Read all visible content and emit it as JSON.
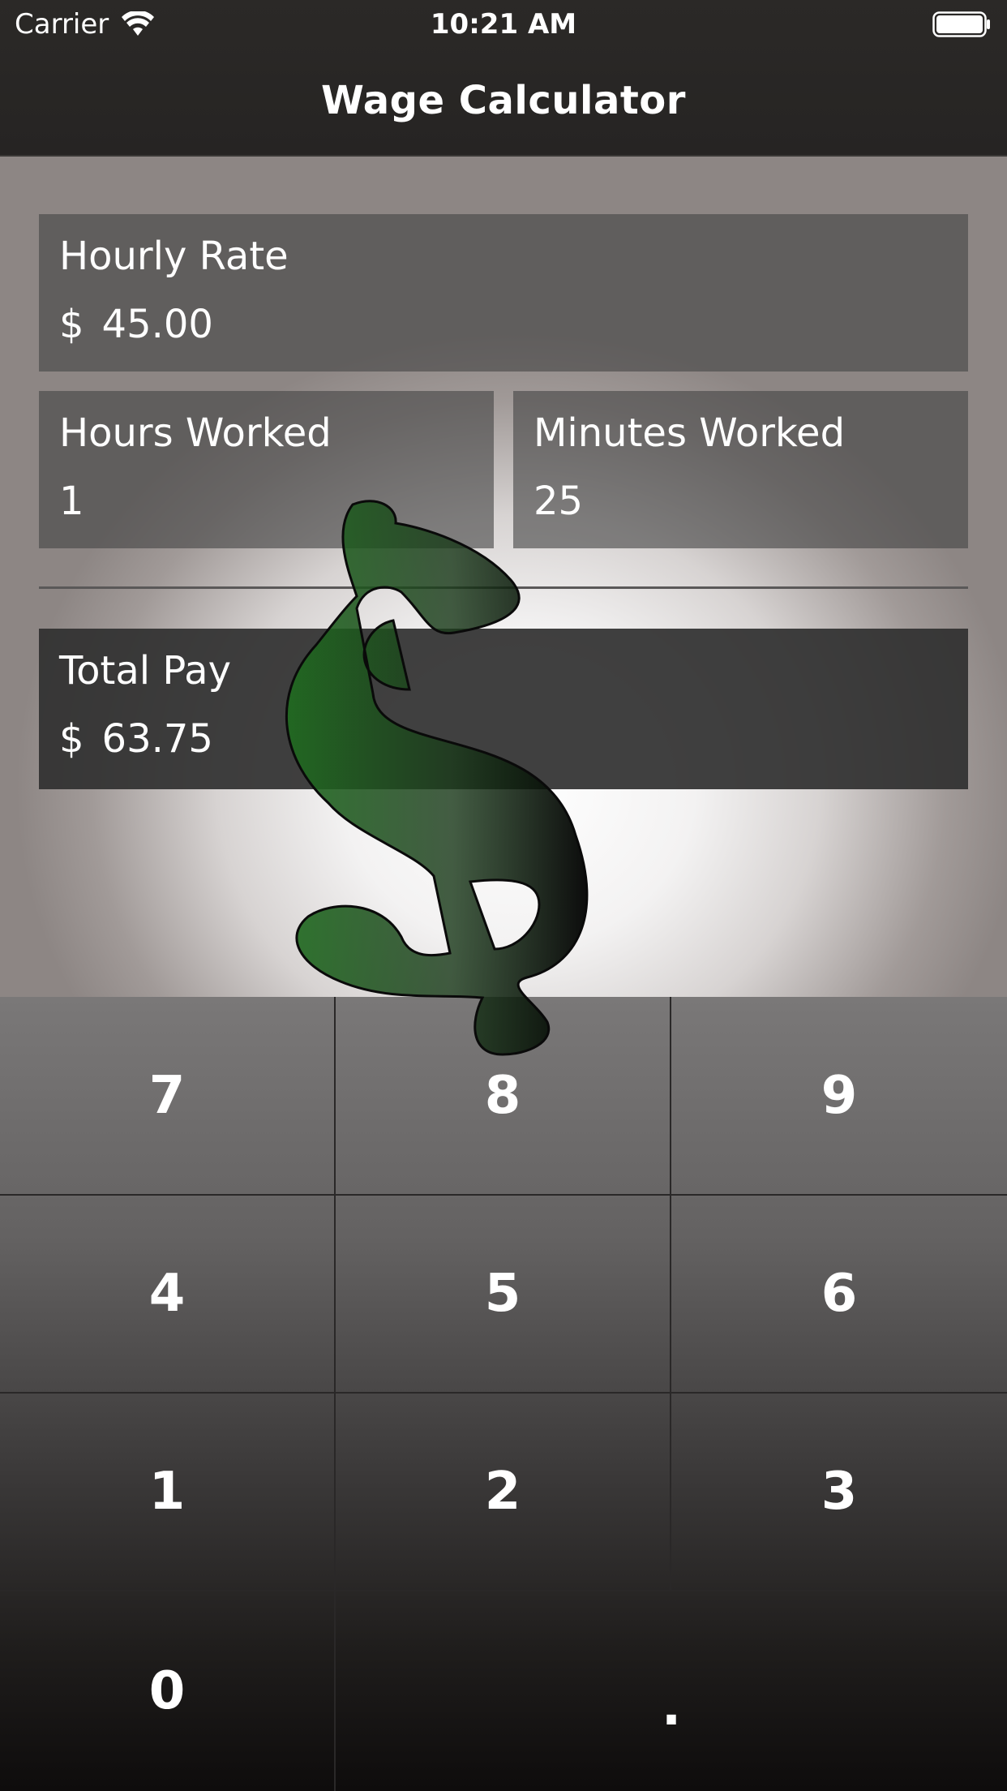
{
  "status_bar": {
    "carrier": "Carrier",
    "time": "10:21 AM"
  },
  "nav": {
    "title": "Wage Calculator"
  },
  "fields": {
    "hourly_rate": {
      "label": "Hourly Rate",
      "currency": "$",
      "value": "45.00"
    },
    "hours_worked": {
      "label": "Hours Worked",
      "value": "1"
    },
    "minutes_worked": {
      "label": "Minutes Worked",
      "value": "25"
    },
    "total_pay": {
      "label": "Total Pay",
      "currency": "$",
      "value": "63.75"
    }
  },
  "keypad": {
    "keys": [
      "7",
      "8",
      "9",
      "4",
      "5",
      "6",
      "1",
      "2",
      "3",
      "0",
      "."
    ]
  },
  "icons": {
    "wifi": "wifi-icon",
    "battery": "battery-icon",
    "watermark": "dollar-sign-icon"
  },
  "colors": {
    "nav_background": "#272523",
    "field_background": "#464646",
    "total_background": "#303030",
    "dollar_green": "#1f6b1f"
  }
}
